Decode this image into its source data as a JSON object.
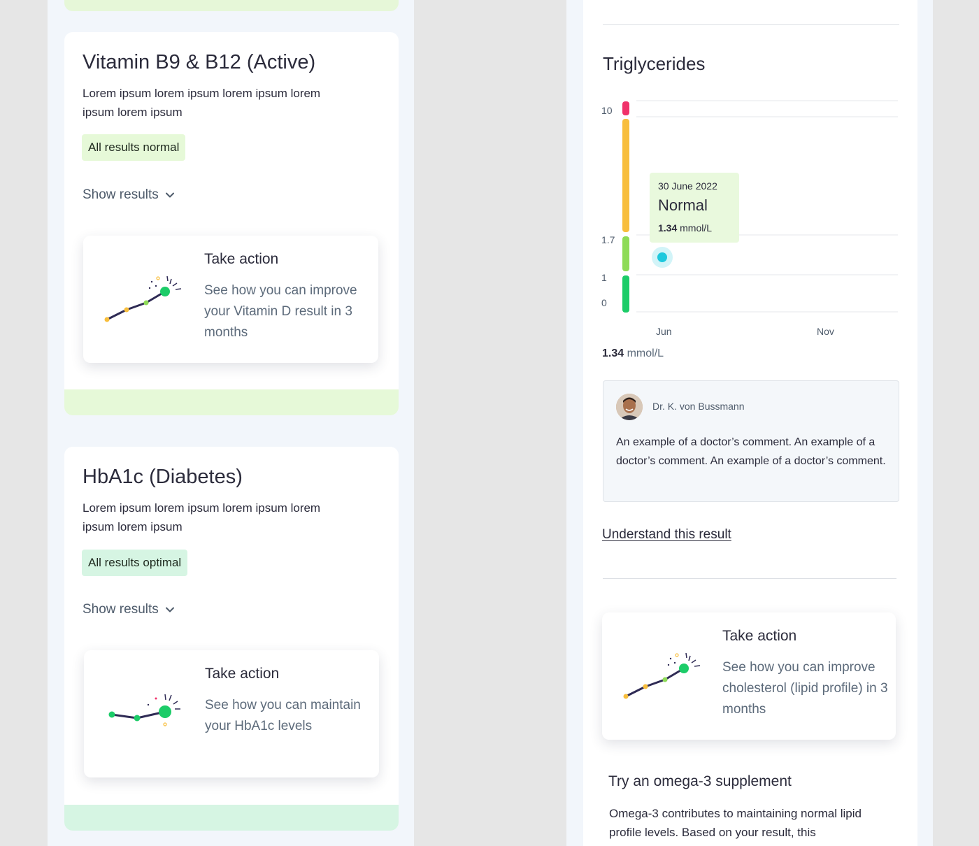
{
  "left": {
    "cards": [
      {
        "title": "Vitamin B9 & B12 (Active)",
        "description": "Lorem ipsum lorem ipsum lorem ipsum lorem ipsum lorem ipsum",
        "badge": "All results normal",
        "show_results": "Show results",
        "action": {
          "title": "Take action",
          "text": "See how you can improve your Vitamin D result in 3 months"
        }
      },
      {
        "title": "HbA1c (Diabetes)",
        "description": "Lorem ipsum lorem ipsum lorem ipsum lorem ipsum lorem ipsum",
        "badge": "All results optimal",
        "show_results": "Show results",
        "action": {
          "title": "Take action",
          "text": "See how you can maintain your HbA1c levels"
        }
      }
    ]
  },
  "right": {
    "title": "Triglycerides",
    "tooltip": {
      "date": "30 June 2022",
      "status": "Normal",
      "value": "1.34",
      "unit": "mmol/L"
    },
    "result": {
      "value": "1.34",
      "unit": "mmol/L"
    },
    "comment": {
      "doctor": "Dr. K. von Bussmann",
      "text": "An example of a doctor’s comment. An example of a doctor’s comment. An example of a doctor’s comment."
    },
    "understand_link": "Understand this result",
    "action": {
      "title": "Take action",
      "text": "See how you can improve cholesterol (lipid profile) in 3 months"
    },
    "omega": {
      "title": "Try an omega-3 supplement",
      "text": "Omega-3 contributes to maintaining normal lipid profile levels. Based on your result, this"
    }
  },
  "colors": {
    "range_high": "#f0326a",
    "range_elevated": "#f8be3c",
    "range_normal": "#8edb57",
    "range_optimal": "#1ccc68",
    "data_point": "#1ec8dd",
    "badge_normal": "#e6f9d8",
    "badge_optimal": "#d6f5e3"
  },
  "chart_data": {
    "type": "scatter",
    "title": "Triglycerides",
    "y_ticks": [
      "10",
      "1.7",
      "1",
      "0"
    ],
    "x_ticks": [
      "Jun",
      "Nov"
    ],
    "points": [
      {
        "x": "30 June 2022",
        "y": 1.34
      }
    ],
    "ranges": [
      {
        "from": 0,
        "to": 1,
        "color": "#1ccc68"
      },
      {
        "from": 1,
        "to": 1.7,
        "color": "#8edb57"
      },
      {
        "from": 1.7,
        "to": 10,
        "color": "#f8be3c"
      },
      {
        "from": 10,
        "to": null,
        "color": "#f0326a"
      }
    ],
    "unit": "mmol/L",
    "grid": true
  }
}
